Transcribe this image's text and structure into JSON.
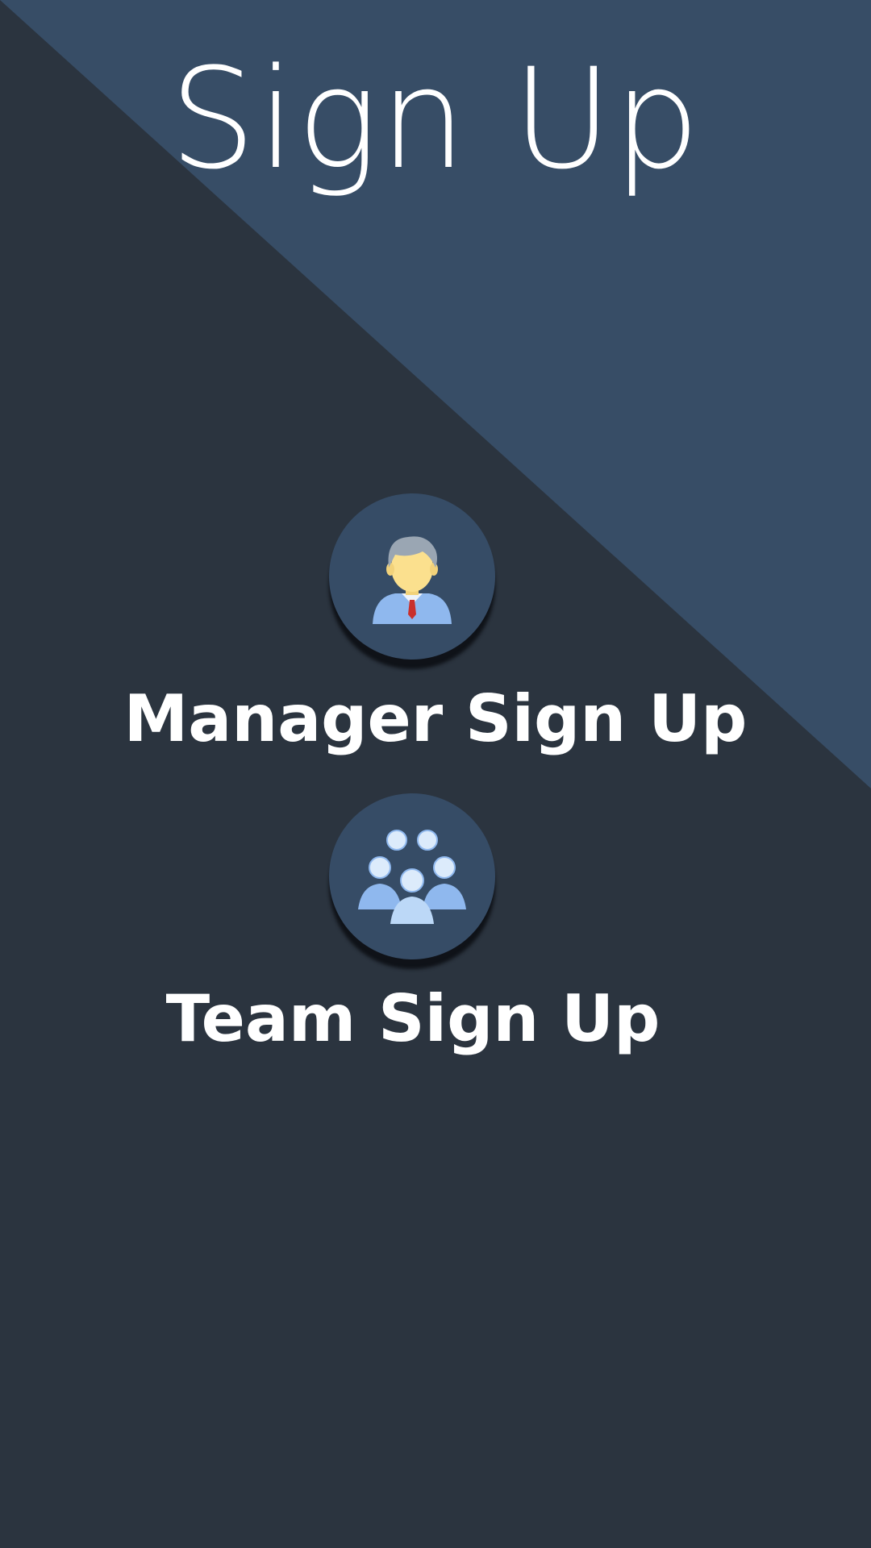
{
  "page": {
    "title": "Sign Up"
  },
  "options": {
    "manager": {
      "label": "Manager Sign Up",
      "icon": "manager-icon"
    },
    "team": {
      "label": "Team Sign Up",
      "icon": "team-icon"
    }
  },
  "colors": {
    "background_dark": "#2b343f",
    "background_accent": "#364c66",
    "text": "#ffffff"
  }
}
